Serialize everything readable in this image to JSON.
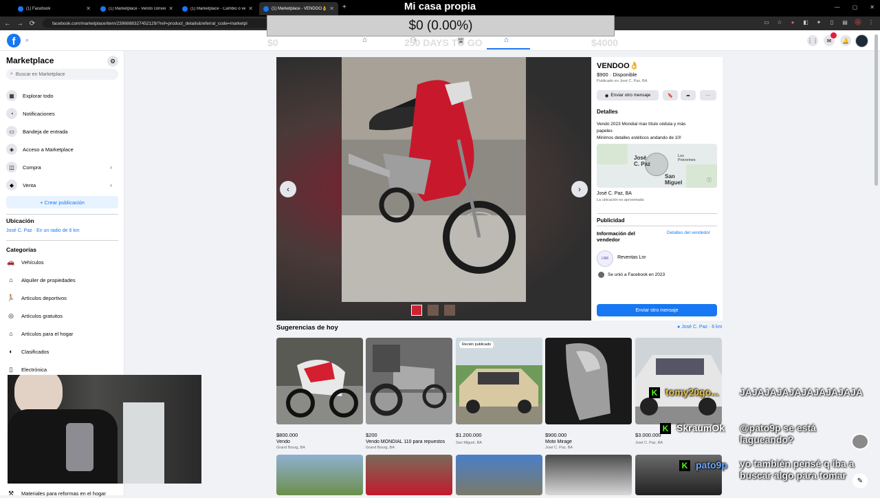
{
  "browser": {
    "tabs": [
      {
        "label": "(1) Facebook",
        "active": false
      },
      {
        "label": "(1) Marketplace - Vendo conver",
        "active": false
      },
      {
        "label": "(1) Marketplace - Cambio o ve",
        "active": false
      },
      {
        "label": "(1) Marketplace - VENDOO👌",
        "active": true
      }
    ],
    "new_tab": "+",
    "url": "facebook.com/marketplace/item/2396888327452129/?ref=product_details&referral_code=marketpl"
  },
  "overlay": {
    "title": "Mi casa propia",
    "price_display": "$0 (0.00%)",
    "ghost_left": "$0",
    "ghost_middle": "250 DAYS TO GO",
    "ghost_right": "$4000"
  },
  "sidebar": {
    "title": "Marketplace",
    "search_placeholder": "Buscar en Marketplace",
    "nav": [
      {
        "label": "Explorar todo",
        "icon": "storefront-icon"
      },
      {
        "label": "Notificaciones",
        "icon": "bell-icon"
      },
      {
        "label": "Bandeja de entrada",
        "icon": "inbox-icon"
      },
      {
        "label": "Acceso a Marketplace",
        "icon": "shield-icon"
      },
      {
        "label": "Compra",
        "icon": "bag-icon"
      },
      {
        "label": "Venta",
        "icon": "tag-icon"
      }
    ],
    "create_label": "+ Crear publicación",
    "location_heading": "Ubicación",
    "location_value": "José C. Paz · En un radio de 6 km",
    "categories_heading": "Categorías",
    "categories": [
      {
        "label": "Vehículos",
        "icon": "car-icon"
      },
      {
        "label": "Alquiler de propiedades",
        "icon": "house-key-icon"
      },
      {
        "label": "Artículos deportivos",
        "icon": "running-icon"
      },
      {
        "label": "Artículos gratuitos",
        "icon": "gift-icon"
      },
      {
        "label": "Artículos para el hogar",
        "icon": "home-icon"
      },
      {
        "label": "Clasificados",
        "icon": "classified-icon"
      },
      {
        "label": "Electrónica",
        "icon": "phone-icon"
      }
    ],
    "last_category": "Materiales para reformas en el hogar"
  },
  "listing": {
    "title": "VENDOO👌",
    "price_status": "$900 · Disponible",
    "published": "Publicado en José C. Paz, BA",
    "message_again": "Enviar otro mensaje",
    "details_heading": "Detalles",
    "description_line1": "Vendo 2023 Mondial max título cédula y más",
    "description_line2": "papeles",
    "description_line3": "Minimos detalles estéticos andando de 10!",
    "map_label_a": "José\nC. Paz",
    "map_label_b": "Los\nPolvorines",
    "map_label_c": "San\nMiguel",
    "location": "José C. Paz, BA",
    "location_note": "La ubicación es aproximada",
    "publicity": "Publicidad",
    "seller_info": "Información del vendedor",
    "seller_details": "Detalles del vendedor",
    "seller_name": "Reventas Lnr",
    "seller_joined": "Se unió a Facebook en 2023",
    "send_button": "Enviar otro mensaje"
  },
  "suggestions": {
    "heading": "Sugerencias de hoy",
    "location": "José C. Paz · 6 km",
    "cards": [
      {
        "price": "$800.000",
        "title": "Vendo",
        "loc": "Grand Bourg, BA",
        "badge": ""
      },
      {
        "price": "$200",
        "title": "Vendo MONDIAL 110 para repuestos",
        "loc": "Grand Bourg, BA",
        "badge": ""
      },
      {
        "price": "$1.200.000",
        "title": "",
        "loc": "San Miguel, BA",
        "badge": "Recién publicado"
      },
      {
        "price": "$900.000",
        "title": "Moto Mirage",
        "loc": "José C. Paz, BA",
        "badge": ""
      },
      {
        "price": "$3.000.000",
        "title": "",
        "loc": "José C. Paz, BA",
        "badge": ""
      }
    ]
  },
  "chat": [
    {
      "user": "tomy20go...",
      "message": "JAJAJAJAJAJAJAJAJAJA",
      "badge": "K"
    },
    {
      "user": "SkraumOk",
      "message": "@pato9p se está lagueando?",
      "badge": "K"
    },
    {
      "user": "pato9p",
      "message": "yo también pensé q iba a buscar algo para tomar",
      "badge": "K"
    }
  ],
  "colors": {
    "fb_blue": "#1877f2",
    "chat_user_yellow": "#e6c74a",
    "chat_user_white": "#ffffff",
    "chat_user_blue": "#6aa8ff",
    "kick_green": "#53fc18"
  }
}
